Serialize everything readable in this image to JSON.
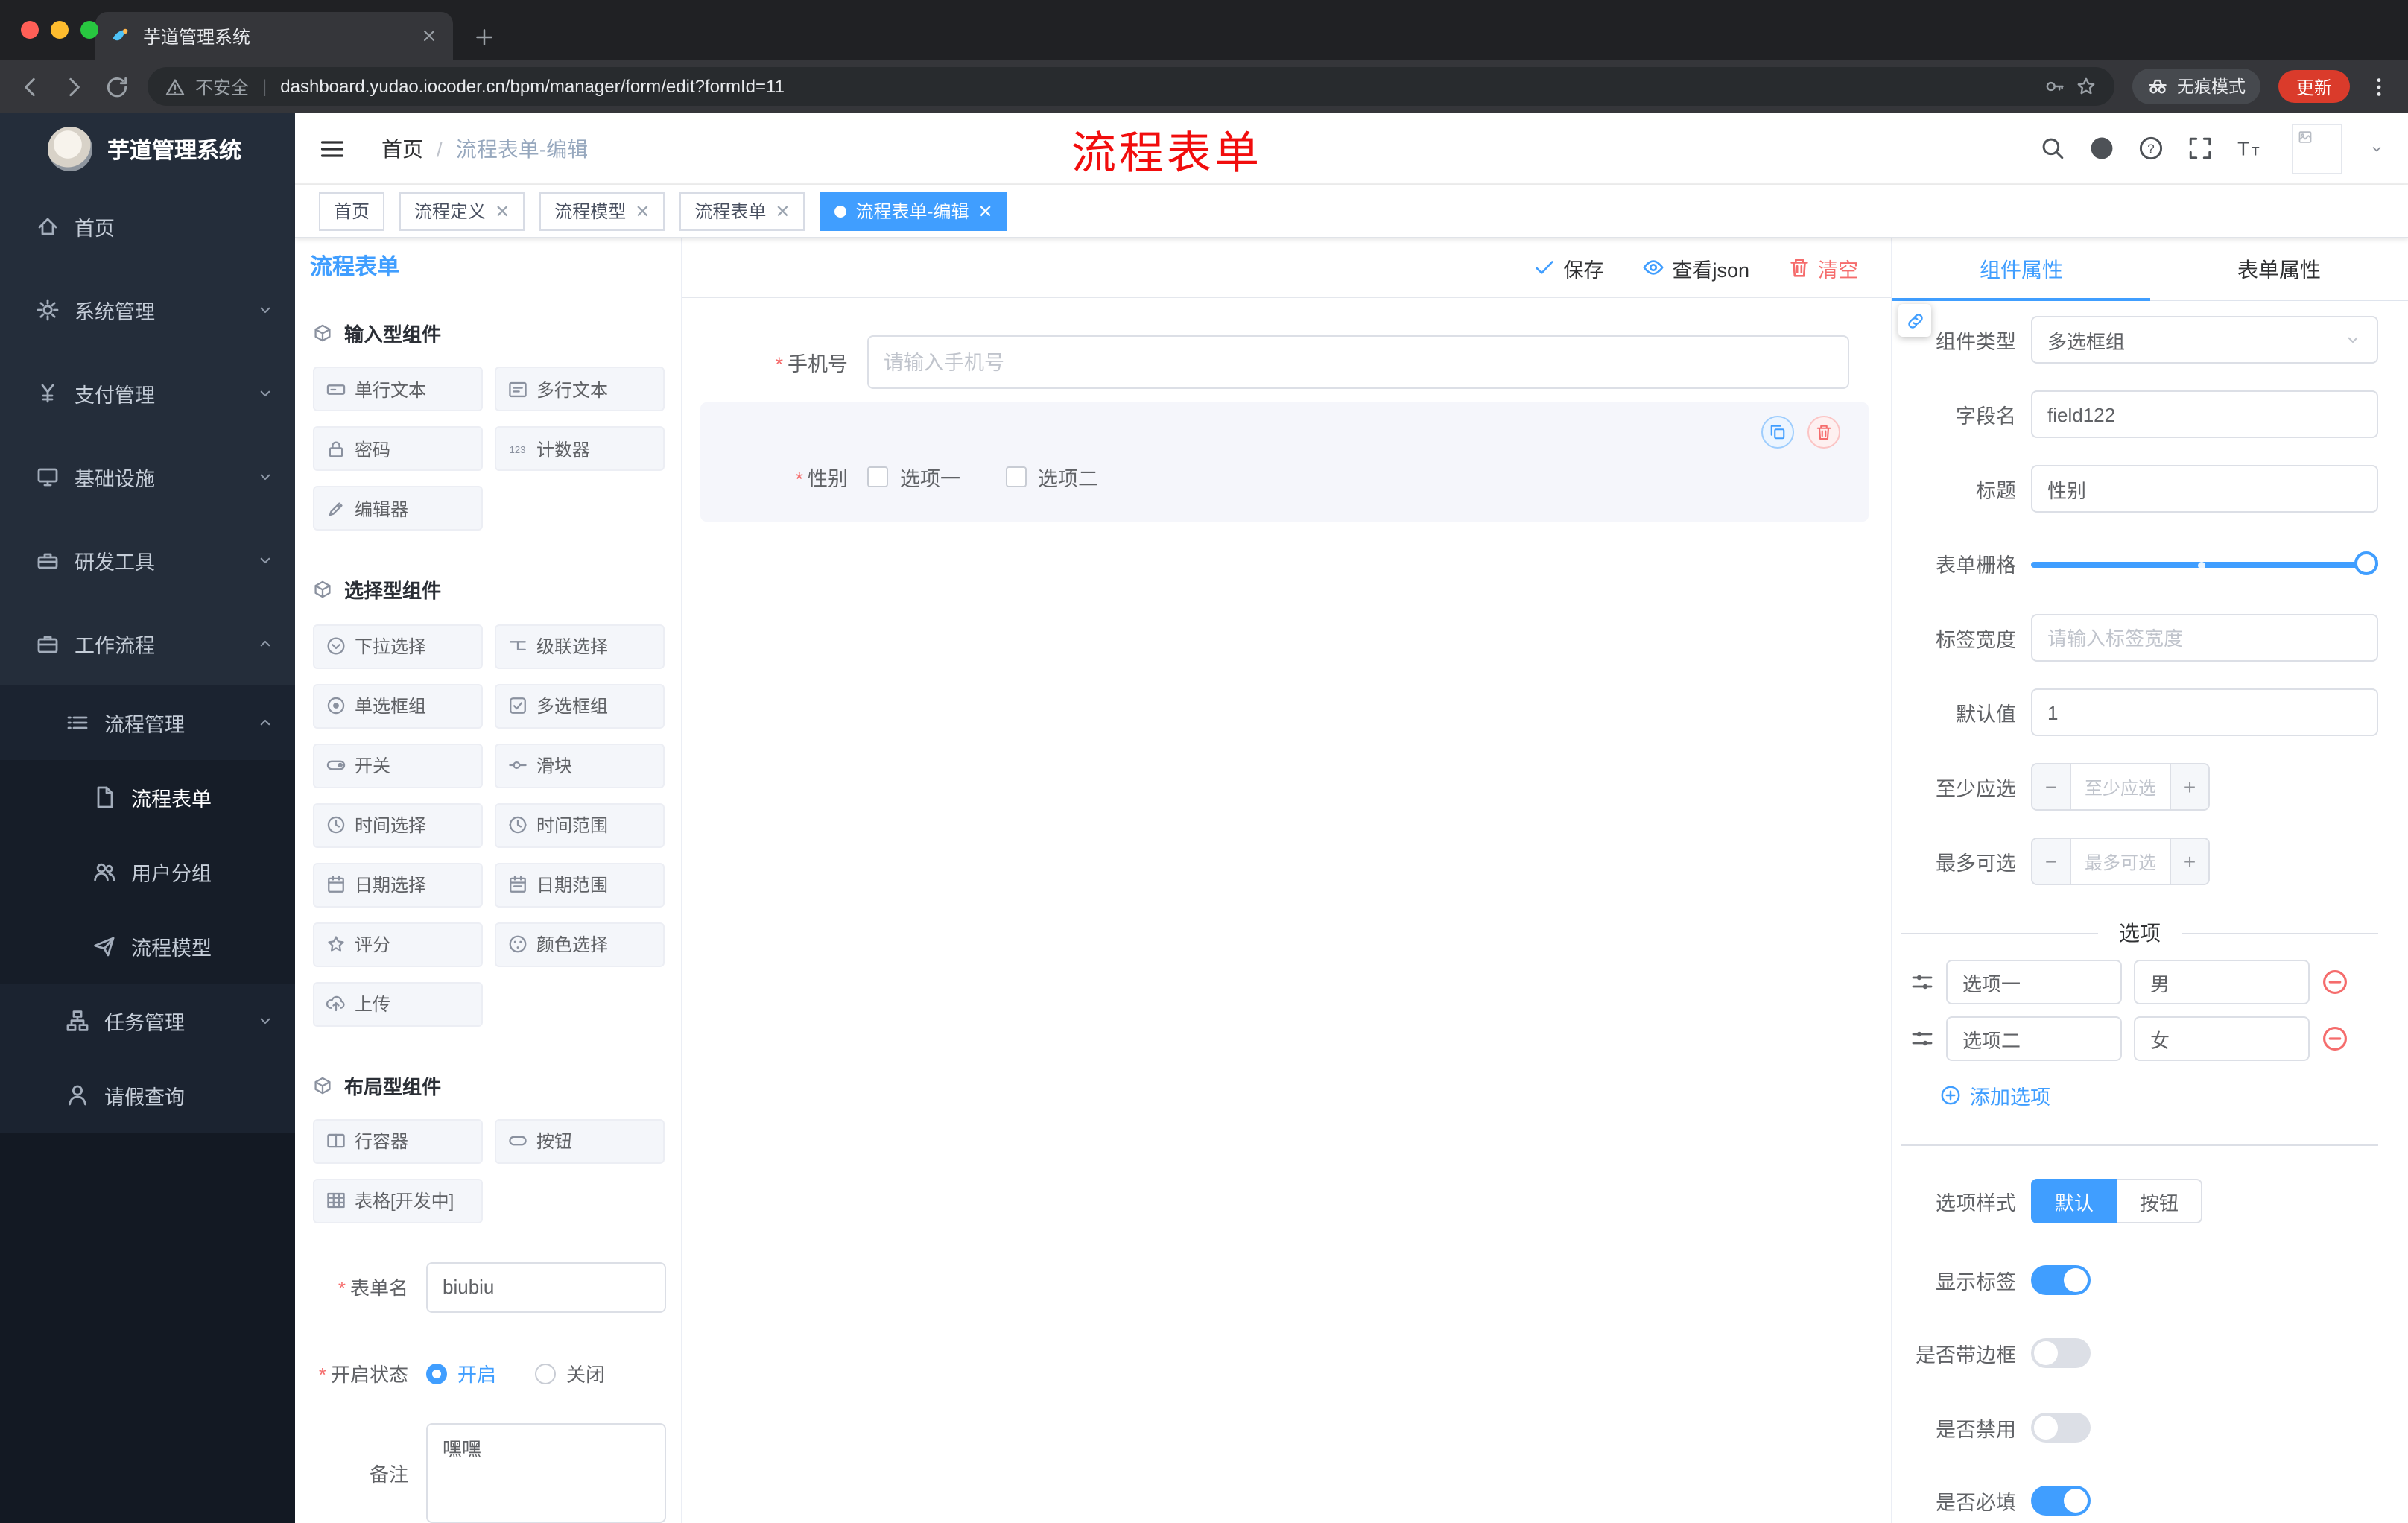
{
  "annotation": "流程表单",
  "colors": {
    "accent": "#409eff",
    "danger": "#f56c6c",
    "annotation_red": "#f10d0d",
    "sidebar_bg": "#242d3a"
  },
  "browser": {
    "tab_title": "芋道管理系统",
    "security_label": "不安全",
    "url": "dashboard.yudao.iocoder.cn/bpm/manager/form/edit?formId=11",
    "incognito_label": "无痕模式",
    "update_label": "更新"
  },
  "sidebar": {
    "logo_title": "芋道管理系统",
    "items": [
      {
        "label": "首页",
        "icon": "home-icon"
      },
      {
        "label": "系统管理",
        "icon": "gear-icon"
      },
      {
        "label": "支付管理",
        "icon": "yen-icon"
      },
      {
        "label": "基础设施",
        "icon": "monitor-icon"
      },
      {
        "label": "研发工具",
        "icon": "toolbox-icon"
      },
      {
        "label": "工作流程",
        "icon": "briefcase-icon"
      },
      {
        "label": "流程管理",
        "icon": "list-icon"
      },
      {
        "label": "流程表单",
        "icon": "document-icon"
      },
      {
        "label": "用户分组",
        "icon": "users-icon"
      },
      {
        "label": "流程模型",
        "icon": "send-icon"
      },
      {
        "label": "任务管理",
        "icon": "tree-icon"
      },
      {
        "label": "请假查询",
        "icon": "person-icon"
      }
    ]
  },
  "header": {
    "breadcrumb_home": "首页",
    "breadcrumb_current": "流程表单-编辑"
  },
  "tags": [
    {
      "label": "首页"
    },
    {
      "label": "流程定义"
    },
    {
      "label": "流程模型"
    },
    {
      "label": "流程表单"
    },
    {
      "label": "流程表单-编辑"
    }
  ],
  "designer": {
    "panel_title": "流程表单",
    "actions": {
      "save": "保存",
      "view_json": "查看json",
      "clear": "清空"
    },
    "groups": [
      {
        "title": "输入型组件",
        "items": [
          {
            "label": "单行文本",
            "icon": "input-field-icon"
          },
          {
            "label": "多行文本",
            "icon": "textarea-field-icon"
          },
          {
            "label": "密码",
            "icon": "password-field-icon"
          },
          {
            "label": "计数器",
            "icon": "counter-field-icon"
          },
          {
            "label": "编辑器",
            "icon": "editor-field-icon"
          }
        ]
      },
      {
        "title": "选择型组件",
        "items": [
          {
            "label": "下拉选择",
            "icon": "select-field-icon"
          },
          {
            "label": "级联选择",
            "icon": "cascader-field-icon"
          },
          {
            "label": "单选框组",
            "icon": "radio-field-icon"
          },
          {
            "label": "多选框组",
            "icon": "checkbox-field-icon"
          },
          {
            "label": "开关",
            "icon": "switch-field-icon"
          },
          {
            "label": "滑块",
            "icon": "slider-field-icon"
          },
          {
            "label": "时间选择",
            "icon": "time-field-icon"
          },
          {
            "label": "时间范围",
            "icon": "time-range-field-icon"
          },
          {
            "label": "日期选择",
            "icon": "date-field-icon"
          },
          {
            "label": "日期范围",
            "icon": "date-range-field-icon"
          },
          {
            "label": "评分",
            "icon": "rate-field-icon"
          },
          {
            "label": "颜色选择",
            "icon": "color-field-icon"
          },
          {
            "label": "上传",
            "icon": "upload-field-icon"
          }
        ]
      },
      {
        "title": "布局型组件",
        "items": [
          {
            "label": "行容器",
            "icon": "row-field-icon"
          },
          {
            "label": "按钮",
            "icon": "button-field-icon"
          },
          {
            "label": "表格[开发中]",
            "icon": "table-field-icon"
          }
        ]
      }
    ],
    "meta": {
      "name_label": "表单名",
      "name_value": "biubiu",
      "status_label": "开启状态",
      "status_on": "开启",
      "status_off": "关闭",
      "remark_label": "备注",
      "remark_value": "嘿嘿"
    },
    "canvas": {
      "phone_label": "手机号",
      "phone_placeholder": "请输入手机号",
      "gender_label": "性别",
      "gender_options": [
        "选项一",
        "选项二"
      ]
    }
  },
  "properties": {
    "tab_component": "组件属性",
    "tab_form": "表单属性",
    "component_type_label": "组件类型",
    "component_type_value": "多选框组",
    "field_name_label": "字段名",
    "field_name_value": "field122",
    "title_label": "标题",
    "title_value": "性别",
    "grid_label": "表单栅格",
    "label_width_label": "标签宽度",
    "label_width_placeholder": "请输入标签宽度",
    "default_label": "默认值",
    "default_value": "1",
    "min_label": "至少应选",
    "min_placeholder": "至少应选",
    "max_label": "最多可选",
    "max_placeholder": "最多可选",
    "options_title": "选项",
    "options": [
      {
        "label": "选项一",
        "value": "男"
      },
      {
        "label": "选项二",
        "value": "女"
      }
    ],
    "add_option": "添加选项",
    "style_label": "选项样式",
    "style_default": "默认",
    "style_button": "按钮",
    "toggles": [
      {
        "label": "显示标签",
        "on": true
      },
      {
        "label": "是否带边框",
        "on": false
      },
      {
        "label": "是否禁用",
        "on": false
      },
      {
        "label": "是否必填",
        "on": true
      }
    ]
  }
}
